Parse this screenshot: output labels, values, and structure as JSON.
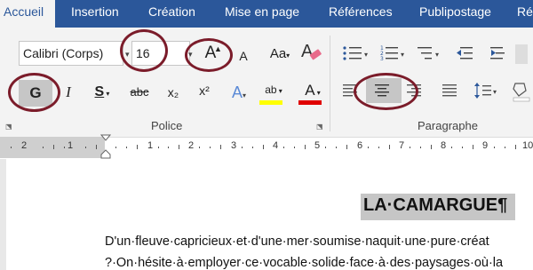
{
  "tabs": [
    {
      "label": "Accueil",
      "active": true
    },
    {
      "label": "Insertion",
      "active": false
    },
    {
      "label": "Création",
      "active": false
    },
    {
      "label": "Mise en page",
      "active": false
    },
    {
      "label": "Références",
      "active": false
    },
    {
      "label": "Publipostage",
      "active": false
    },
    {
      "label": "Ré",
      "active": false
    }
  ],
  "font": {
    "font_name": "Calibri (Corps)",
    "font_size": "16",
    "grow_font_label": "A",
    "shrink_font_label": "A",
    "change_case_label": "Aa",
    "bold_label": "G",
    "italic_label": "I",
    "underline_label": "S",
    "strike_label": "abc",
    "subscript_label": "x₂",
    "superscript_label": "x²",
    "text_effects_label": "A",
    "highlight_label": "ab",
    "font_color_label": "A",
    "group_label": "Police"
  },
  "paragraph": {
    "group_label": "Paragraphe",
    "active_alignment": "center"
  },
  "ruler": {
    "numbers": [
      "2",
      "1",
      "1",
      "2",
      "3",
      "4",
      "5",
      "6",
      "7",
      "8",
      "9",
      "10"
    ]
  },
  "document": {
    "title": "LA·CAMARGUE¶",
    "line1": "D'un·fleuve·capricieux·et·d'une·mer·soumise·naquit·une·pure·créat",
    "line2": "?·On·hésite·à·employer·ce·vocable·solide·face·à·des·paysages·où·la"
  },
  "colors": {
    "tab_bar": "#2b579a",
    "ribbon": "#f3f3f3",
    "annotation_circle": "#7b1c2a",
    "highlight_yellow": "#ffff00",
    "font_color_red": "#e00000",
    "selection_gray": "#c6c6c6"
  }
}
